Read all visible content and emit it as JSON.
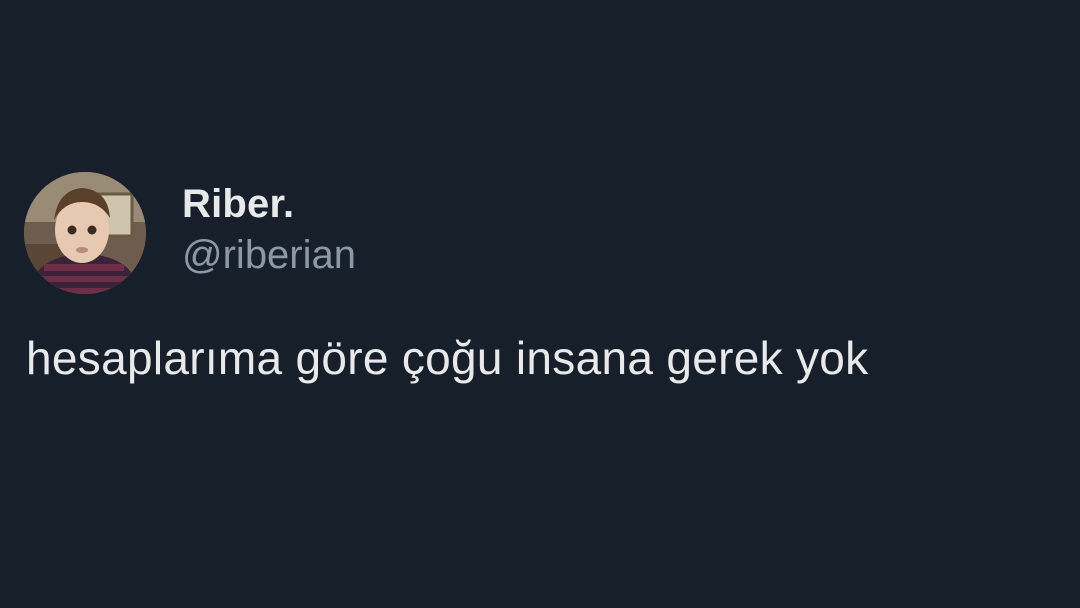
{
  "tweet": {
    "author": {
      "display_name": "Riber.",
      "handle": "@riberian",
      "avatar_icon": "child-portrait-avatar"
    },
    "text": "hesaplarıma göre çoğu insana gerek yok"
  },
  "colors": {
    "background": "#17202a",
    "primary_text": "#e7e9ea",
    "secondary_text": "#8b98a5"
  }
}
